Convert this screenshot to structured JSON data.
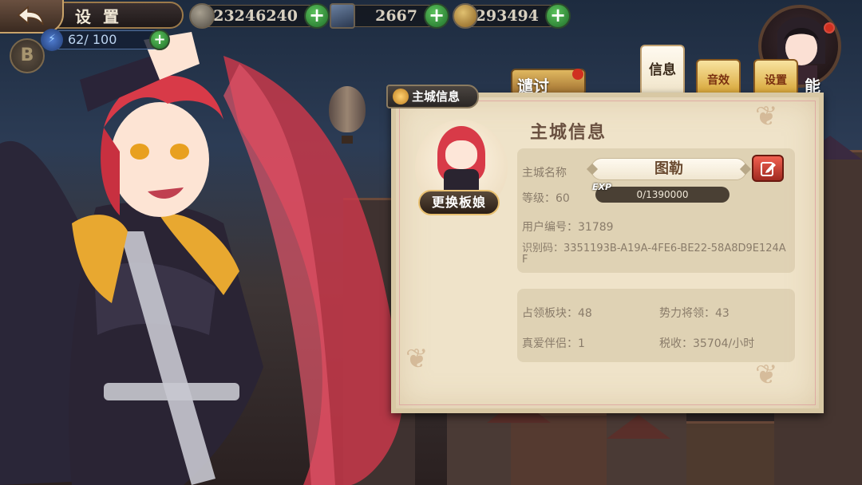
{
  "header": {
    "title": "设 置"
  },
  "resources": {
    "coins": "223246240",
    "tickets": "2667",
    "gold": "59293494",
    "energy": "62/ 100"
  },
  "side_labels": [
    "谴讨",
    "能"
  ],
  "tabs": [
    {
      "label": "信息",
      "active": true
    },
    {
      "label": "音效",
      "active": false
    },
    {
      "label": "设置",
      "active": false
    }
  ],
  "panel": {
    "ribbon": "主城信息",
    "heading": "主城信息",
    "change_button": "更换板娘",
    "city_name_label": "主城名称",
    "city_name": "图勒",
    "level": "等级：60",
    "exp_tag": "EXP",
    "exp_progress": "0/1390000",
    "exp_fraction": 0,
    "user_id": "用户编号：31789",
    "identifier_line1": "识别码：3351193B-A19A-4FE6-BE22-58A8D9E124A",
    "identifier_line2": "F",
    "stats": {
      "territory": "占领板块：48",
      "generals": "势力将领：43",
      "partners": "真爱伴侣：1",
      "tax": "税收：35704/小时"
    }
  },
  "colors": {
    "panel_bg": "#efe3c9",
    "tab_gold": "#d6a230",
    "plus_green": "#3aa040",
    "edit_red": "#e04a3a"
  },
  "icons": {
    "back": "back-arrow-icon",
    "coin": "coin-icon",
    "ticket": "ticket-icon",
    "gold": "gold-coin-icon",
    "energy": "lightning-icon",
    "plus": "plus-icon",
    "edit": "pencil-icon"
  }
}
